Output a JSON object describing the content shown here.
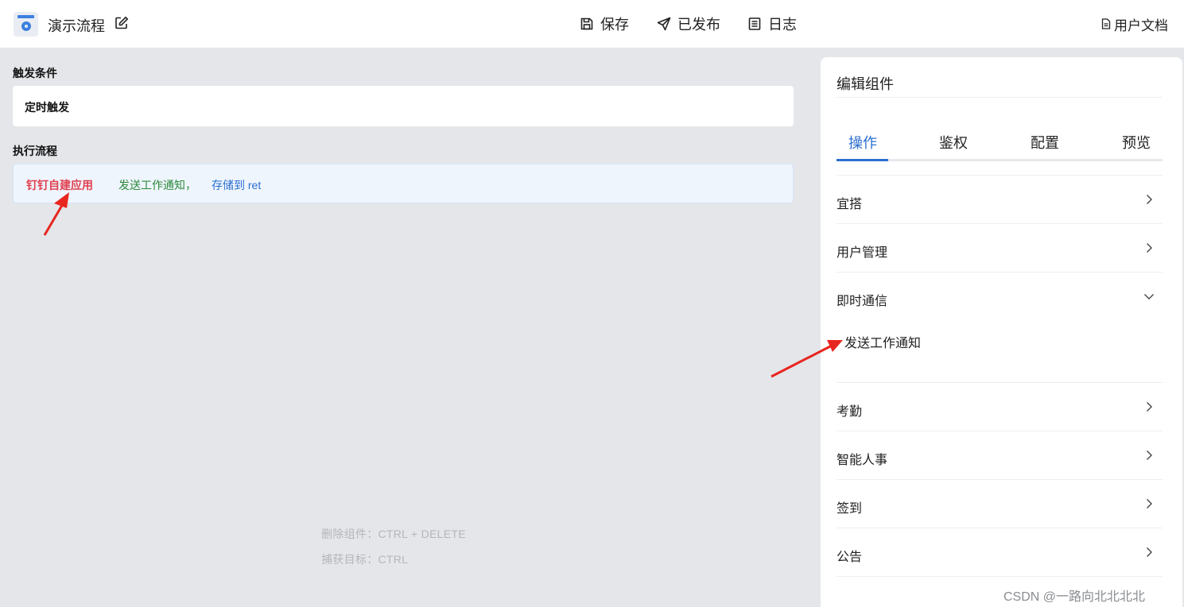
{
  "header": {
    "title": "演示流程",
    "save_label": "保存",
    "publish_label": "已发布",
    "log_label": "日志",
    "docs_label": "用户文档"
  },
  "canvas": {
    "trigger_section_label": "触发条件",
    "trigger_value": "定时触发",
    "flow_section_label": "执行流程",
    "flow_step": {
      "app": "钉钉自建应用",
      "action": "发送工作通知，",
      "store": "存储到 ret"
    },
    "hints": [
      "删除组件：CTRL + DELETE",
      "捕获目标：CTRL"
    ]
  },
  "panel": {
    "title": "编辑组件",
    "tabs": [
      "操作",
      "鉴权",
      "配置",
      "预览"
    ],
    "active_tab": "操作",
    "menu": [
      {
        "label": "宜搭",
        "expanded": false
      },
      {
        "label": "用户管理",
        "expanded": false
      },
      {
        "label": "即时通信",
        "expanded": true,
        "children": [
          "发送工作通知"
        ]
      },
      {
        "label": "考勤",
        "expanded": false
      },
      {
        "label": "智能人事",
        "expanded": false
      },
      {
        "label": "签到",
        "expanded": false
      },
      {
        "label": "公告",
        "expanded": false
      }
    ]
  },
  "colors": {
    "accent": "#2b6fd0",
    "app_red": "#e0404f",
    "action_green": "#2d8a3a",
    "canvas_bg": "#e4e6ea",
    "annotation_arrow": "#e8261f"
  },
  "watermark": "CSDN @一路向北北北北"
}
